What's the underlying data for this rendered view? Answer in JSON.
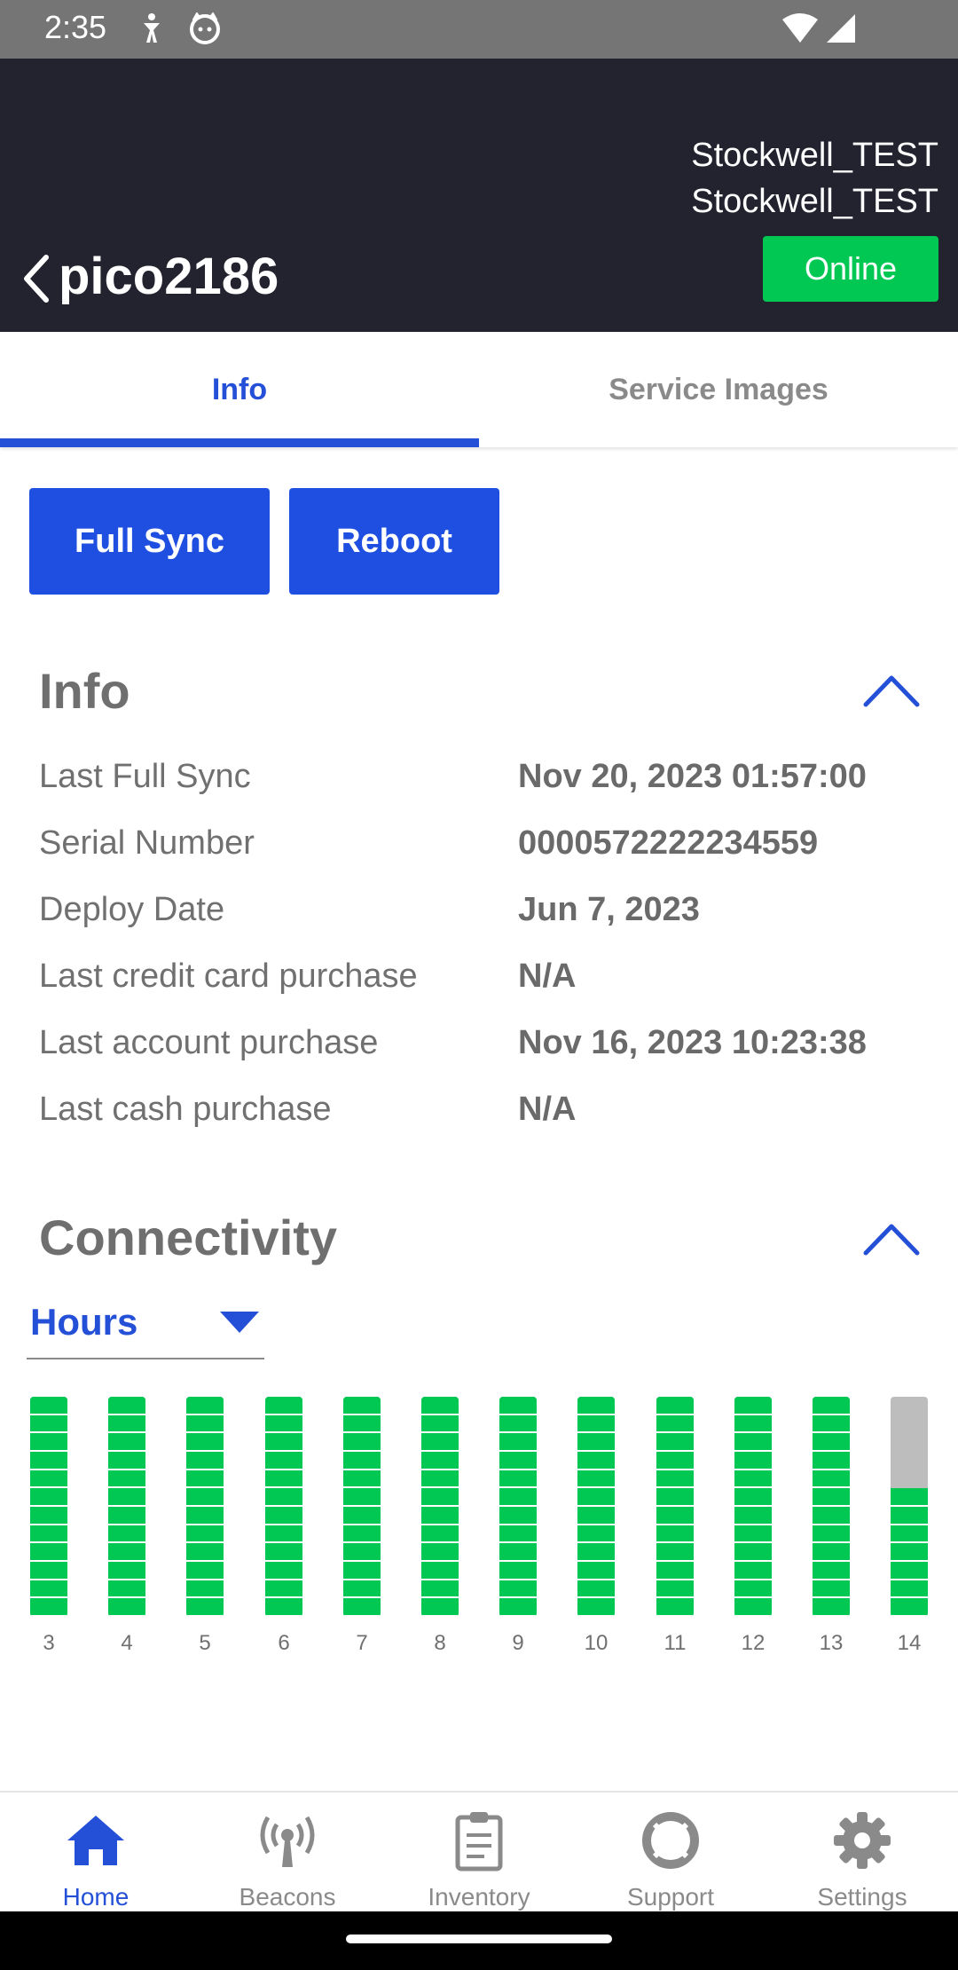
{
  "status_bar": {
    "time": "2:35"
  },
  "header": {
    "org_lines": [
      "Stockwell_TEST",
      "Stockwell_TEST"
    ],
    "device": "pico2186",
    "status": "Online"
  },
  "tabs": [
    {
      "label": "Info"
    },
    {
      "label": "Service Images"
    }
  ],
  "actions": {
    "full_sync": "Full Sync",
    "reboot": "Reboot"
  },
  "info": {
    "title": "Info",
    "rows": [
      {
        "label": "Last Full Sync",
        "value": "Nov 20, 2023 01:57:00"
      },
      {
        "label": "Serial Number",
        "value": "0000572222234559"
      },
      {
        "label": "Deploy Date",
        "value": "Jun 7, 2023"
      },
      {
        "label": "Last credit card purchase",
        "value": "N/A"
      },
      {
        "label": "Last account purchase",
        "value": "Nov 16, 2023 10:23:38"
      },
      {
        "label": "Last cash purchase",
        "value": "N/A"
      }
    ]
  },
  "connectivity": {
    "title": "Connectivity",
    "range_selected": "Hours",
    "colors": {
      "online": "#00c853",
      "offline": "#bdbdbd"
    }
  },
  "chart_data": {
    "type": "bar",
    "categories": [
      "3",
      "4",
      "5",
      "6",
      "7",
      "8",
      "9",
      "10",
      "11",
      "12",
      "13",
      "14"
    ],
    "values": [
      1,
      1,
      1,
      1,
      1,
      1,
      1,
      1,
      1,
      1,
      1,
      0.583
    ],
    "ylim": [
      0,
      1
    ],
    "segments_per_bar": 12
  },
  "bottom_nav": [
    {
      "label": "Home",
      "icon": "home-icon",
      "active": true
    },
    {
      "label": "Beacons",
      "icon": "beacon-icon"
    },
    {
      "label": "Inventory",
      "icon": "clipboard-icon"
    },
    {
      "label": "Support",
      "icon": "lifebuoy-icon"
    },
    {
      "label": "Settings",
      "icon": "gear-icon"
    }
  ],
  "colors": {
    "accent": "#2450d8",
    "header_bg": "#23232f",
    "online": "#00c853"
  }
}
